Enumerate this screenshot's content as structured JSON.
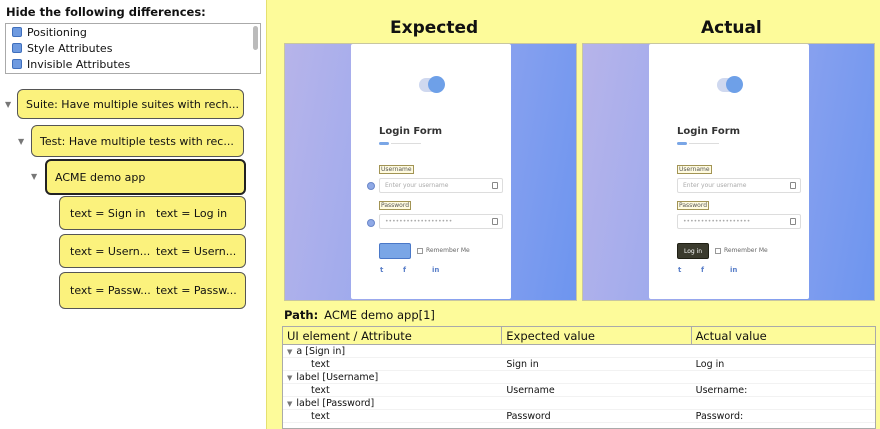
{
  "filters": {
    "title": "Hide the following differences:",
    "items": [
      "Positioning",
      "Style Attributes",
      "Invisible Attributes"
    ]
  },
  "tree": {
    "suite": "Suite: Have multiple suites with rech...",
    "test": "Test: Have multiple tests with rec...",
    "app": "ACME demo app",
    "diffs": [
      {
        "expected": "text = Sign in",
        "actual": "text = Log in"
      },
      {
        "expected": "text = Usern...",
        "actual": "text = Usern..."
      },
      {
        "expected": "text = Passw...",
        "actual": "text = Passw..."
      }
    ]
  },
  "compare": {
    "expected_title": "Expected",
    "actual_title": "Actual",
    "form_title": "Login Form",
    "username_label": "Username",
    "username_placeholder": "Enter your username",
    "password_label": "Password",
    "password_placeholder": "•••••••••••••••••••",
    "remember": "Remember Me",
    "expected_button": "",
    "actual_button": "Log in",
    "social": [
      "t",
      "f",
      "in"
    ]
  },
  "details": {
    "path_label": "Path:",
    "path_value": "ACME demo app[1]",
    "columns": [
      "UI element / Attribute",
      "Expected value",
      "Actual value"
    ],
    "rows": [
      {
        "kind": "parent",
        "element": "a [Sign in]",
        "expected": "",
        "actual": ""
      },
      {
        "kind": "child",
        "element": "text",
        "expected": "Sign in",
        "actual": "Log in"
      },
      {
        "kind": "parent",
        "element": "label [Username]",
        "expected": "",
        "actual": ""
      },
      {
        "kind": "child",
        "element": "text",
        "expected": "Username",
        "actual": "Username:"
      },
      {
        "kind": "parent",
        "element": "label [Password]",
        "expected": "",
        "actual": ""
      },
      {
        "kind": "child",
        "element": "text",
        "expected": "Password",
        "actual": "Password:"
      }
    ]
  },
  "colors": {
    "node_fill": "#fbf27d",
    "panel_bg": "#fdfb9a",
    "checkbox": "#6e9ae0",
    "accent": "#7aa6e6"
  }
}
